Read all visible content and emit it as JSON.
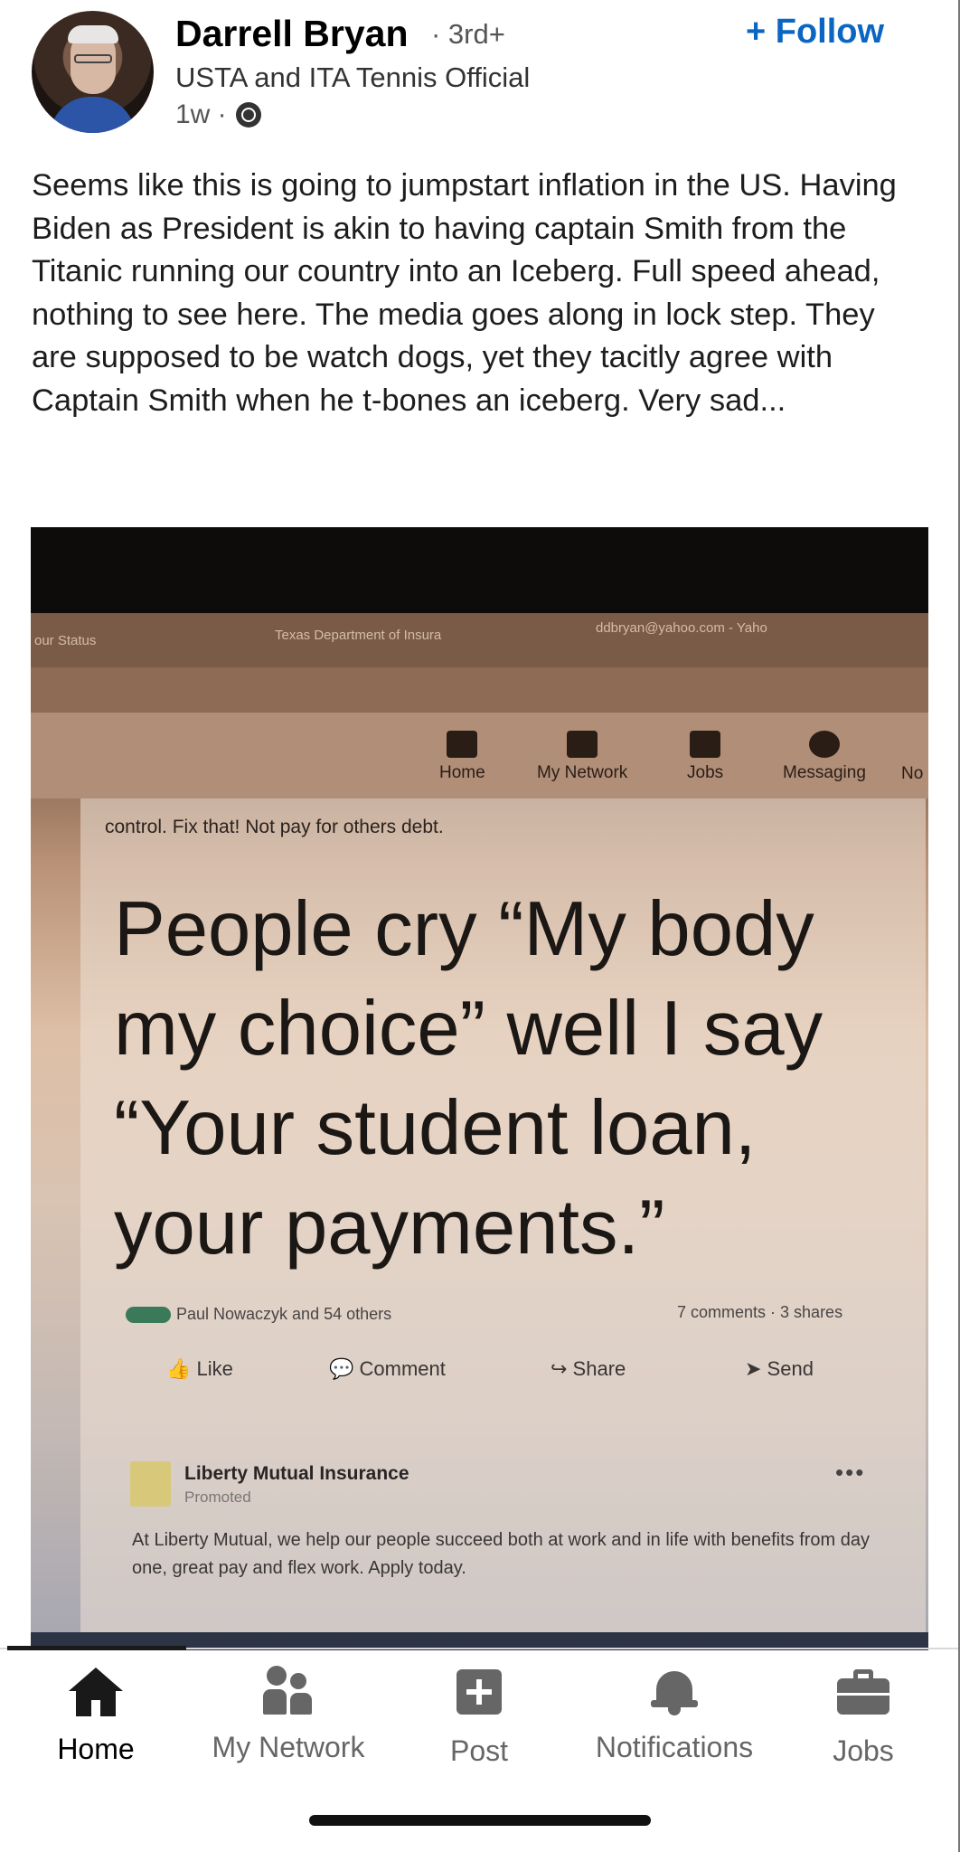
{
  "post": {
    "author": {
      "name": "Darrell Bryan",
      "degree": "· 3rd+",
      "headline": "USTA and ITA Tennis Official",
      "time": "1w ·",
      "visibility_icon": "globe-icon"
    },
    "follow_label": "+ Follow",
    "text": "Seems like this is going to jumpstart inflation in the US.  Having Biden as President is akin to having captain Smith from the Titanic running our country into an Iceberg.  Full speed ahead, nothing to see here.  The media goes along in lock step.  They are supposed to be watch dogs, yet they tacitly agree with Captain Smith when he t-bones an iceberg.  Very sad..."
  },
  "photo": {
    "browser_tabs": [
      "our Status",
      "Texas Department of Insura",
      "ddbryan@yahoo.com - Yaho"
    ],
    "nav": [
      "Home",
      "My Network",
      "Jobs",
      "Messaging",
      "No"
    ],
    "snippet": "control. Fix that! Not pay for others debt.",
    "quote": "People cry “My body my choice” well I say “Your student loan, your payments.”",
    "reactions": "Paul Nowaczyk and 54 others",
    "counts": "7 comments · 3 shares",
    "actions": [
      "Like",
      "Comment",
      "Share",
      "Send"
    ],
    "promo": {
      "name": "Liberty Mutual Insurance",
      "tag": "Promoted",
      "text": "At Liberty Mutual, we help our people succeed both at work and in life with benefits from day one, great pay and flex work. Apply today."
    }
  },
  "bottom_nav": {
    "items": [
      "Home",
      "My Network",
      "Post",
      "Notifications",
      "Jobs"
    ],
    "active": "Home"
  },
  "colors": {
    "accent": "#0a66c2",
    "text": "#1d1d1d",
    "muted": "#666666"
  }
}
